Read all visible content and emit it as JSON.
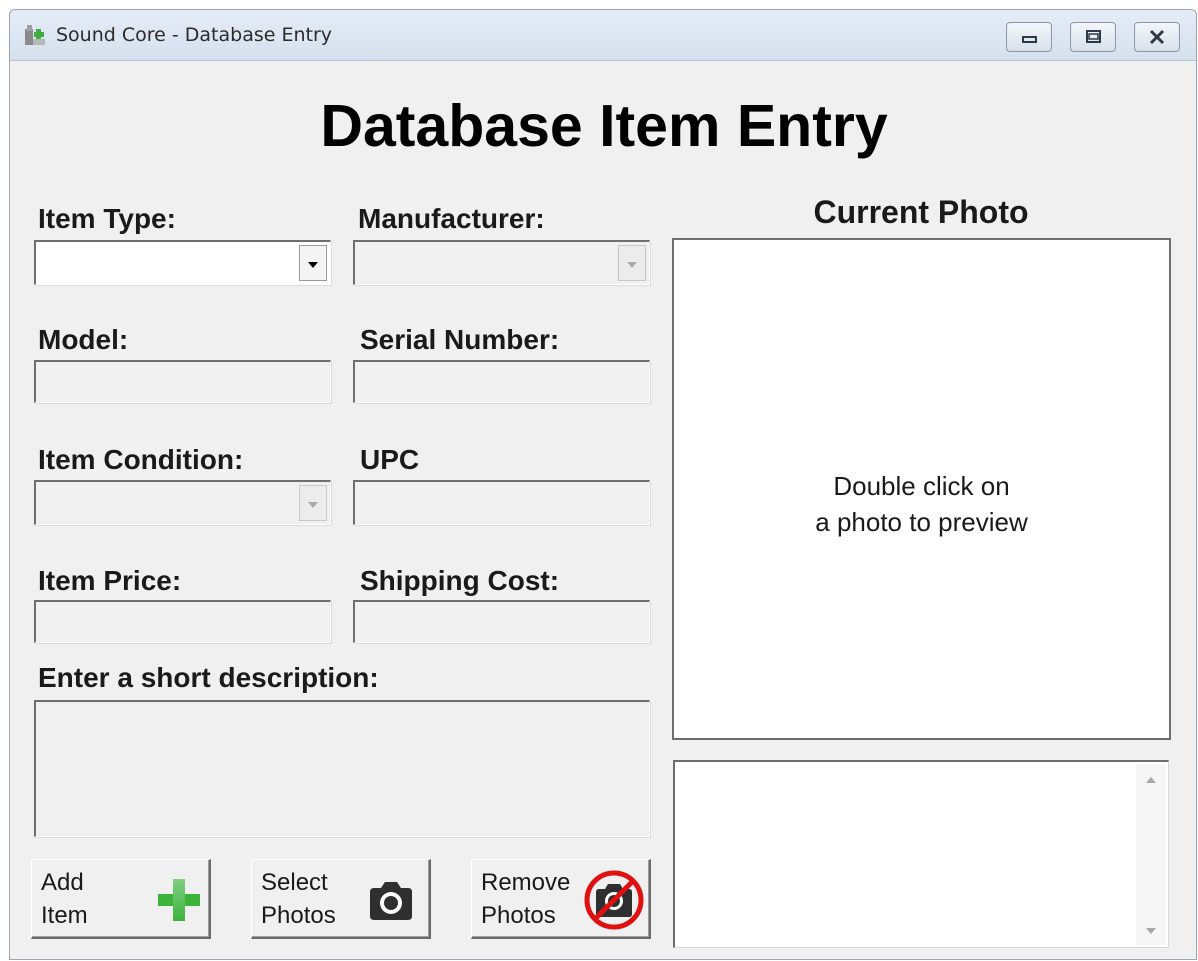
{
  "window": {
    "title": "Sound Core - Database Entry",
    "icons": [
      "app-icon",
      "minimize-icon",
      "restore-icon",
      "close-icon"
    ]
  },
  "heading": "Database Item Entry",
  "form": {
    "item_type": {
      "label": "Item Type:",
      "value": ""
    },
    "manufacturer": {
      "label": "Manufacturer:",
      "value": ""
    },
    "model": {
      "label": "Model:",
      "value": ""
    },
    "serial_number": {
      "label": "Serial Number:",
      "value": ""
    },
    "item_condition": {
      "label": "Item Condition:",
      "value": ""
    },
    "upc": {
      "label": "UPC",
      "value": ""
    },
    "item_price": {
      "label": "Item Price:",
      "value": ""
    },
    "shipping_cost": {
      "label": "Shipping Cost:",
      "value": ""
    },
    "description": {
      "label": "Enter a short description:",
      "value": ""
    }
  },
  "photo": {
    "title": "Current Photo",
    "placeholder_line1": "Double click on",
    "placeholder_line2": "a photo to preview"
  },
  "buttons": {
    "add_line1": "Add",
    "add_line2": "Item",
    "select_line1": "Select",
    "select_line2": "Photos",
    "remove_line1": "Remove",
    "remove_line2": "Photos"
  },
  "colors": {
    "add_icon": "#3cb43c",
    "remove_ring": "#e01010",
    "camera": "#2f2f2f"
  }
}
